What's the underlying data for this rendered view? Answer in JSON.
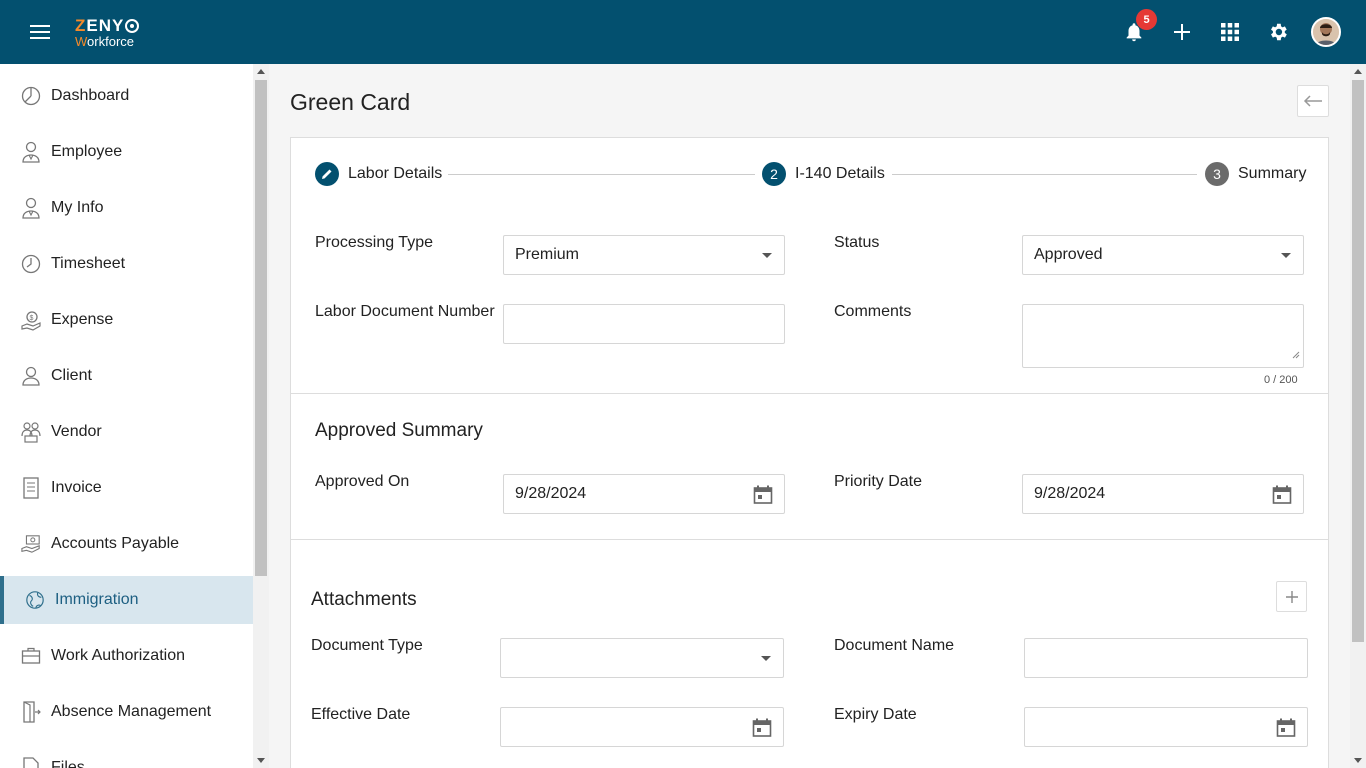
{
  "header": {
    "logo_line1": "ZENY",
    "logo_line2_prefix": "W",
    "logo_line2_rest": "orkforce",
    "notification_count": "5",
    "colors": {
      "bar": "#03506f",
      "accent": "#f58a2a",
      "badge": "#e53935"
    }
  },
  "sidebar": {
    "items": [
      {
        "label": "Dashboard",
        "icon": "dashboard-icon"
      },
      {
        "label": "Employee",
        "icon": "employee-icon"
      },
      {
        "label": "My Info",
        "icon": "my-info-icon"
      },
      {
        "label": "Timesheet",
        "icon": "clock-icon"
      },
      {
        "label": "Expense",
        "icon": "expense-icon"
      },
      {
        "label": "Client",
        "icon": "client-icon"
      },
      {
        "label": "Vendor",
        "icon": "vendor-icon"
      },
      {
        "label": "Invoice",
        "icon": "invoice-icon"
      },
      {
        "label": "Accounts Payable",
        "icon": "accounts-payable-icon"
      },
      {
        "label": "Immigration",
        "icon": "globe-icon",
        "active": true
      },
      {
        "label": "Work Authorization",
        "icon": "briefcase-icon"
      },
      {
        "label": "Absence Management",
        "icon": "exit-door-icon"
      },
      {
        "label": "Files",
        "icon": "files-icon"
      }
    ]
  },
  "page": {
    "title": "Green Card",
    "stepper": [
      {
        "label": "Labor Details",
        "marker": "pencil-icon",
        "state": "completed"
      },
      {
        "label": "I-140 Details",
        "marker": "2",
        "state": "active"
      },
      {
        "label": "Summary",
        "marker": "3",
        "state": "pending"
      }
    ],
    "form": {
      "processing_type_label": "Processing Type",
      "processing_type_value": "Premium",
      "status_label": "Status",
      "status_value": "Approved",
      "labor_doc_label": "Labor Document Number",
      "labor_doc_value": "",
      "comments_label": "Comments",
      "comments_value": "",
      "comments_counter": "0 / 200"
    },
    "approved_summary": {
      "title": "Approved Summary",
      "approved_on_label": "Approved On",
      "approved_on_value": "9/28/2024",
      "priority_date_label": "Priority Date",
      "priority_date_value": "9/28/2024"
    },
    "attachments": {
      "title": "Attachments",
      "document_type_label": "Document Type",
      "document_type_value": "",
      "document_name_label": "Document Name",
      "document_name_value": "",
      "effective_date_label": "Effective Date",
      "effective_date_value": "",
      "expiry_date_label": "Expiry Date",
      "expiry_date_value": ""
    }
  }
}
